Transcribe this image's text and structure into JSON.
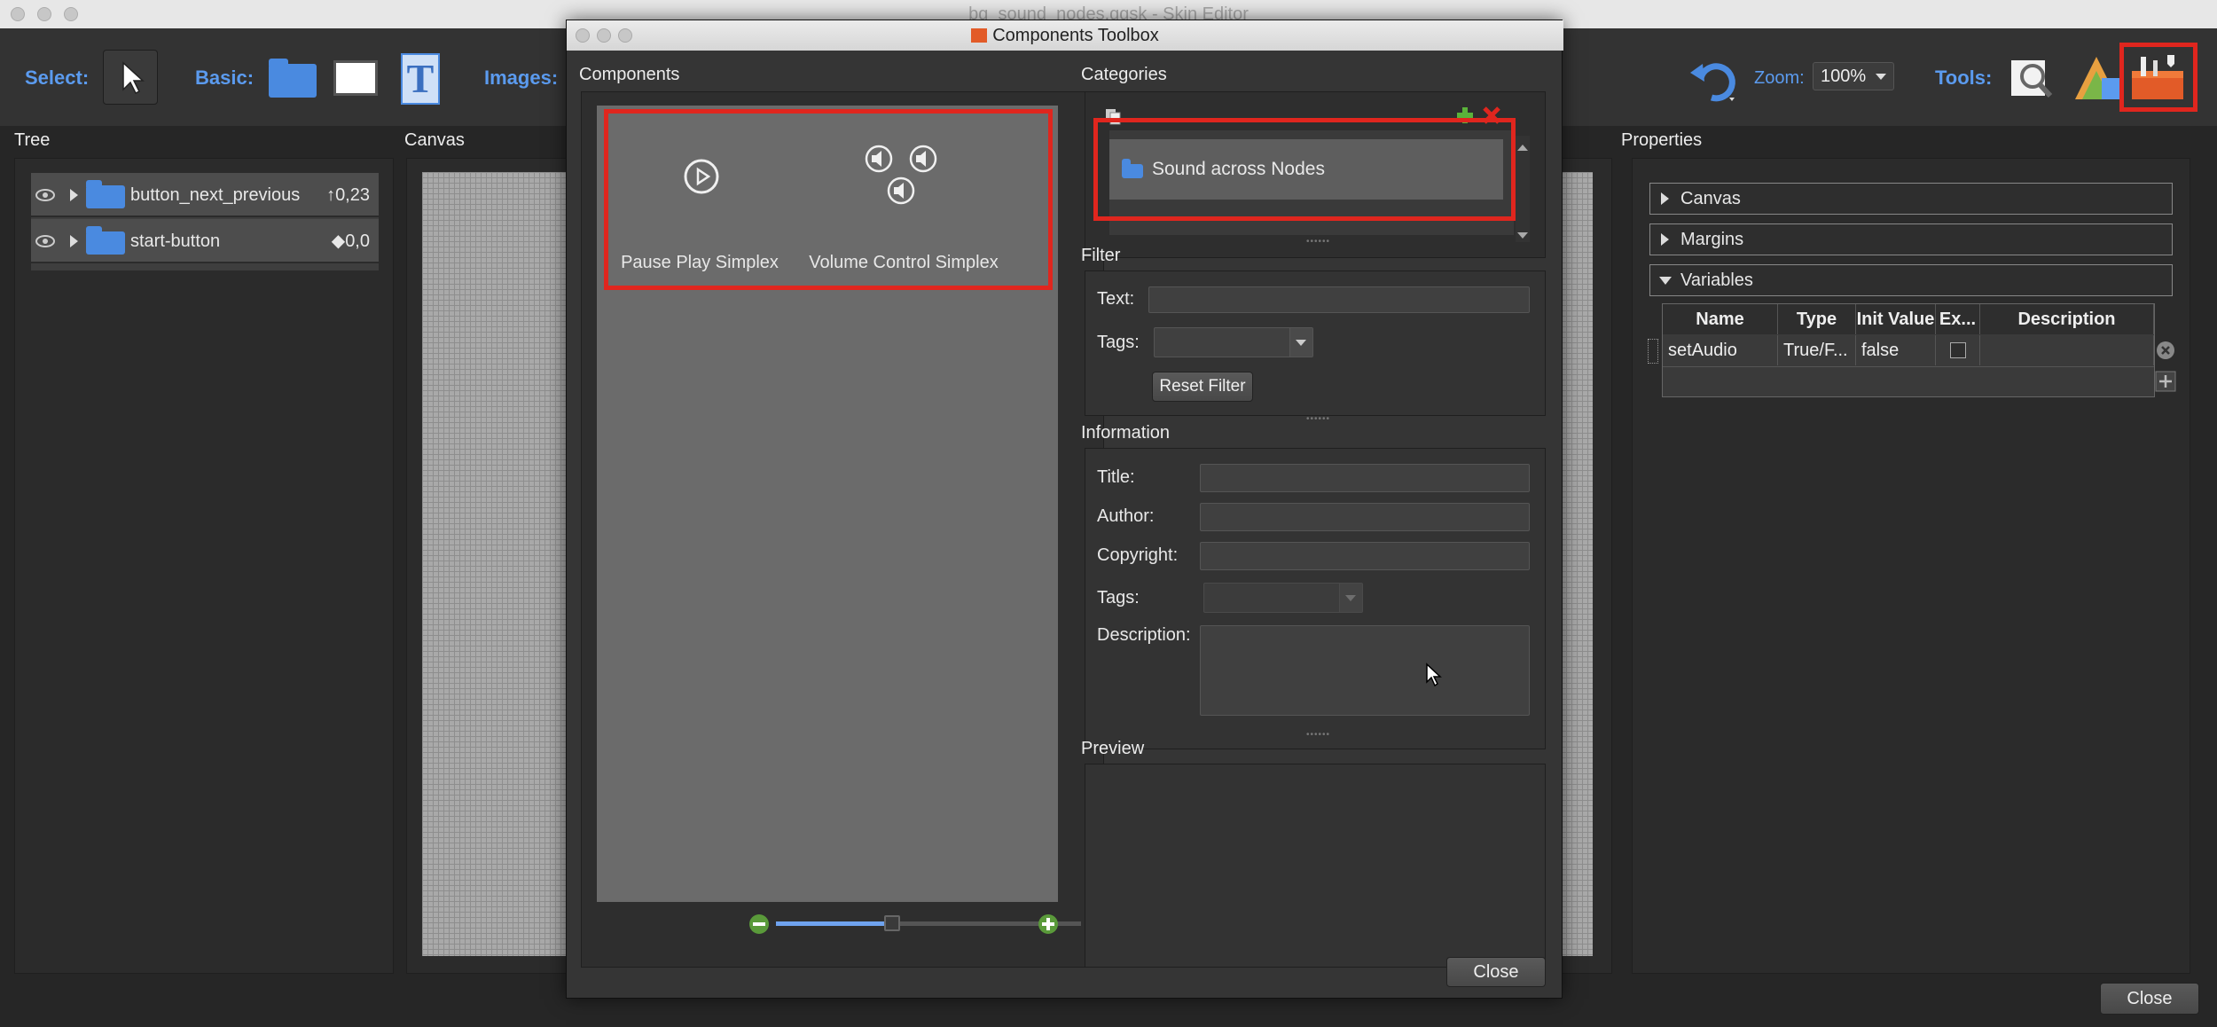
{
  "window": {
    "title": "bg_sound_nodes.ggsk - Skin Editor"
  },
  "toolbar": {
    "select_label": "Select:",
    "basic_label": "Basic:",
    "images_label": "Images:",
    "zoom_label": "Zoom:",
    "zoom_value": "100%",
    "tools_label": "Tools:"
  },
  "tree": {
    "title": "Tree",
    "items": [
      {
        "label": "button_next_previous",
        "value": "0,23"
      },
      {
        "label": "start-button",
        "value": "0,0"
      }
    ]
  },
  "canvas": {
    "title": "Canvas"
  },
  "properties": {
    "title": "Properties",
    "sections": [
      "Canvas",
      "Margins",
      "Variables"
    ],
    "variables": {
      "headers": [
        "Name",
        "Type",
        "Init Value",
        "Ex...",
        "Description"
      ],
      "rows": [
        {
          "name": "setAudio",
          "type": "True/F...",
          "init": "false"
        }
      ]
    }
  },
  "main_close": "Close",
  "dialog": {
    "title": "Components Toolbox",
    "components_title": "Components",
    "components": [
      {
        "label": "Pause Play Simplex",
        "icon": "play-circle-icon"
      },
      {
        "label": "Volume Control Simplex",
        "icon": "volume-controls-icon"
      }
    ],
    "categories_title": "Categories",
    "category_selected": "Sound across Nodes",
    "filter_title": "Filter",
    "filter_text_label": "Text:",
    "filter_tags_label": "Tags:",
    "reset_filter": "Reset Filter",
    "information_title": "Information",
    "info_labels": {
      "title": "Title:",
      "author": "Author:",
      "copyright": "Copyright:",
      "tags": "Tags:",
      "description": "Description:"
    },
    "preview_title": "Preview",
    "close": "Close"
  },
  "colors": {
    "accent": "#5b9bef",
    "highlight": "#e0261e",
    "slider": "#6fa3ef"
  }
}
